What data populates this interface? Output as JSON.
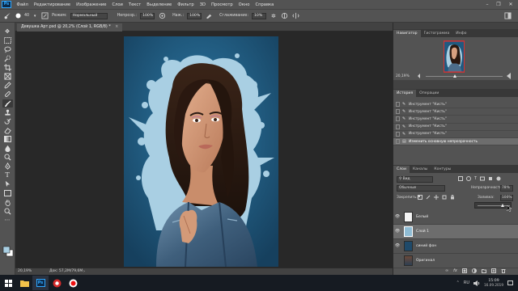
{
  "app": {
    "logo": "Ps",
    "menu": [
      "Файл",
      "Редактирование",
      "Изображение",
      "Слои",
      "Текст",
      "Выделение",
      "Фильтр",
      "3D",
      "Просмотр",
      "Окно",
      "Справка"
    ]
  },
  "options": {
    "brush_size": "40",
    "mode_label": "Режим:",
    "mode_value": "Нормальный",
    "opacity_label": "Непрозр.:",
    "opacity_value": "100%",
    "flow_label": "Наж.:",
    "flow_value": "100%",
    "smoothing_label": "Сглаживание:",
    "smoothing_value": "10%"
  },
  "document": {
    "tab_title": "Девушка Арт.psd @ 20,2% (Слой 1, RGB/8) *",
    "zoom_status": "20,19%",
    "doc_status": "Док: 57,2M/79,6M"
  },
  "navigator": {
    "tabs": [
      "Навигатор",
      "Гистограмма",
      "Инфо"
    ],
    "zoom": "20,19%"
  },
  "history": {
    "tabs": [
      "История",
      "Операции"
    ],
    "rows": [
      "Инструмент \"Кисть\"",
      "Инструмент \"Кисть\"",
      "Инструмент \"Кисть\"",
      "Инструмент \"Кисть\"",
      "Инструмент \"Кисть\"",
      "Изменить основную непрозрачность"
    ]
  },
  "layers_panel": {
    "tabs": [
      "Слои",
      "Каналы",
      "Контуры"
    ],
    "filter_label": "Вид",
    "blend_mode": "Обычные",
    "opacity_label": "Непрозрачность:",
    "opacity_value": "78%",
    "lock_label": "Закрепить:",
    "fill_label": "Заливка:",
    "fill_value": "100%",
    "layers": [
      {
        "name": "Белый",
        "thumb_color": "#f4f4f4"
      },
      {
        "name": "Слой 1",
        "thumb_color": "#8fbcd4"
      },
      {
        "name": "синий фон",
        "thumb_color": "#1f4a6a"
      },
      {
        "name": "Оригинал",
        "thumb_color": "#6b4a3a"
      }
    ]
  },
  "taskbar": {
    "lang": "RU",
    "time": "15:09",
    "date": "16.09.2019"
  },
  "colors": {
    "accent": "#31a8ff",
    "canvas_bg": "#1f5a80",
    "splash": "#a9cfe3"
  }
}
